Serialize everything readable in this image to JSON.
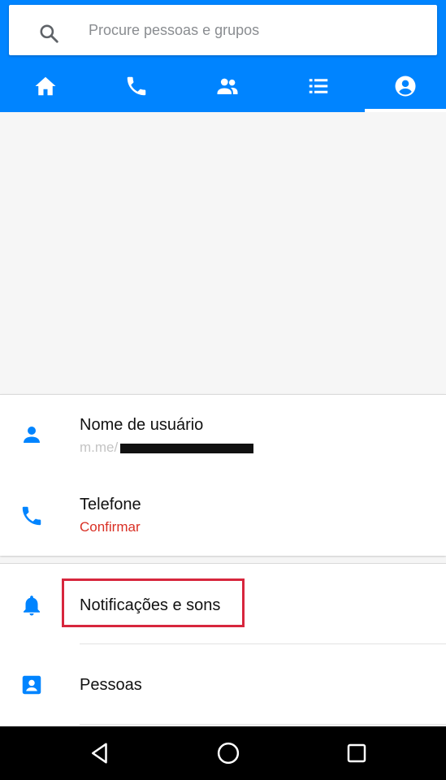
{
  "search": {
    "placeholder": "Procure pessoas e grupos",
    "icon": "search-icon"
  },
  "tabs": [
    {
      "icon": "home-icon",
      "selected": false
    },
    {
      "icon": "phone-icon",
      "selected": false
    },
    {
      "icon": "people-icon",
      "selected": false
    },
    {
      "icon": "list-icon",
      "selected": false
    },
    {
      "icon": "account-icon",
      "selected": true
    }
  ],
  "account": {
    "username_label": "Nome de usuário",
    "username_value": "m.me/",
    "phone_label": "Telefone",
    "phone_action": "Confirmar"
  },
  "settings": {
    "items": [
      {
        "label": "Notificações e sons",
        "icon": "bell-icon",
        "highlighted": true
      },
      {
        "label": "Pessoas",
        "icon": "contacts-icon",
        "highlighted": false
      }
    ]
  },
  "navbar": {
    "buttons": [
      "back-icon",
      "home-circle-icon",
      "recents-icon"
    ]
  },
  "colors": {
    "brand": "#0084ff",
    "accent_red": "#d93025",
    "highlight_border": "#d7263d",
    "icon_blue": "#0084ff"
  }
}
